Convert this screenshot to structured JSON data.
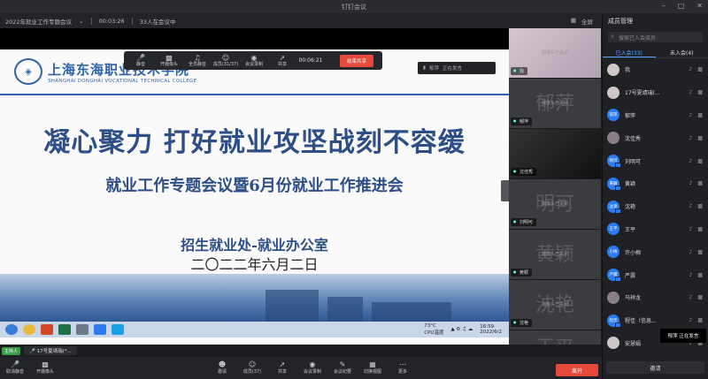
{
  "window": {
    "title": "钉钉会议",
    "fullscreen_label": "全屏"
  },
  "info_bar": {
    "meeting_name": "2022年就业工作专题会议",
    "duration": "00:03:26",
    "participants": "33人在会议中"
  },
  "slide": {
    "logo_cn": "上海东海职业技术学院",
    "logo_en": "SHANGHAI DONGHAI VOCATIONAL TECHNICAL COLLEGE",
    "title": "凝心聚力 打好就业攻坚战刻不容缓",
    "subtitle": "就业工作专题会议暨6月份就业工作推进会",
    "org": "招生就业处-就业办公室",
    "date": "二〇二二年六月二日",
    "taskbar_time": "16:59",
    "taskbar_date": "2022/6/2",
    "taskbar_temp": "73°C",
    "taskbar_cpu": "CPU温度"
  },
  "float_toolbar": {
    "items": [
      "静音",
      "开摄像头",
      "全员静音",
      "成员(31/37)",
      "会议录制",
      "共享"
    ],
    "timer": "00:06:21",
    "stop_label": "结束共享"
  },
  "speaker_pill": {
    "name": "郁萍",
    "status": "正在发言"
  },
  "video_tiles": [
    {
      "name": "我",
      "big": "",
      "cam": "摄像头已关闭",
      "style": "photo"
    },
    {
      "name": "郁萍",
      "big": "郁萍",
      "cam": "摄像头已关闭",
      "style": ""
    },
    {
      "name": "沈佳秀",
      "big": "",
      "cam": "",
      "style": "dark"
    },
    {
      "name": "刘明可",
      "big": "明可",
      "cam": "摄像头已关闭",
      "style": ""
    },
    {
      "name": "黄颖",
      "big": "黄颖",
      "cam": "摄像头已关闭",
      "style": ""
    },
    {
      "name": "沈艳",
      "big": "沈艳",
      "cam": "摄像头已关闭",
      "style": ""
    },
    {
      "name": "",
      "big": "王平",
      "cam": "",
      "style": ""
    }
  ],
  "panel": {
    "title": "成员管理",
    "search_placeholder": "搜索已入会成员",
    "tabs": [
      "已入会(33)",
      "未入会(4)"
    ],
    "members": [
      {
        "name": "我",
        "avatar": "",
        "style": "ph1"
      },
      {
        "name": "17号夏靖瑞(...",
        "avatar": "",
        "style": "ph1"
      },
      {
        "name": "郁萍",
        "avatar": "郁萍",
        "style": ""
      },
      {
        "name": "沈佳秀",
        "avatar": "",
        "style": "ph2"
      },
      {
        "name": "刘明可",
        "avatar": "明可",
        "style": "cam"
      },
      {
        "name": "黄颖",
        "avatar": "黄颖",
        "style": "cam"
      },
      {
        "name": "沈艳",
        "avatar": "沈艳",
        "style": "cam"
      },
      {
        "name": "王平",
        "avatar": "王平",
        "style": ""
      },
      {
        "name": "许小梅",
        "avatar": "小梅",
        "style": ""
      },
      {
        "name": "严震",
        "avatar": "严震",
        "style": "cam"
      },
      {
        "name": "马祥龙",
        "avatar": "",
        "style": "ph2"
      },
      {
        "name": "程佳（信息...",
        "avatar": "程佳",
        "style": "cam"
      },
      {
        "name": "安慧娟",
        "avatar": "",
        "style": "ph1"
      }
    ],
    "invite_label": "邀请"
  },
  "speaking_toast": {
    "name": "郁萍",
    "status": "正在发言"
  },
  "presenter": {
    "host_label": "主持人",
    "name": "17号夏靖瑞(*..."
  },
  "bottom_bar": {
    "items": [
      "取消静音",
      "开摄像头",
      "",
      "",
      "",
      "",
      "",
      "邀请",
      "成员(37)",
      "共享",
      "会议录制",
      "会议纪要",
      "切换视图",
      "更多"
    ],
    "leave_label": "离开"
  },
  "colors": {
    "accent": "#2f63a8",
    "leave": "#e54a3c",
    "host": "#3b9a4a"
  }
}
